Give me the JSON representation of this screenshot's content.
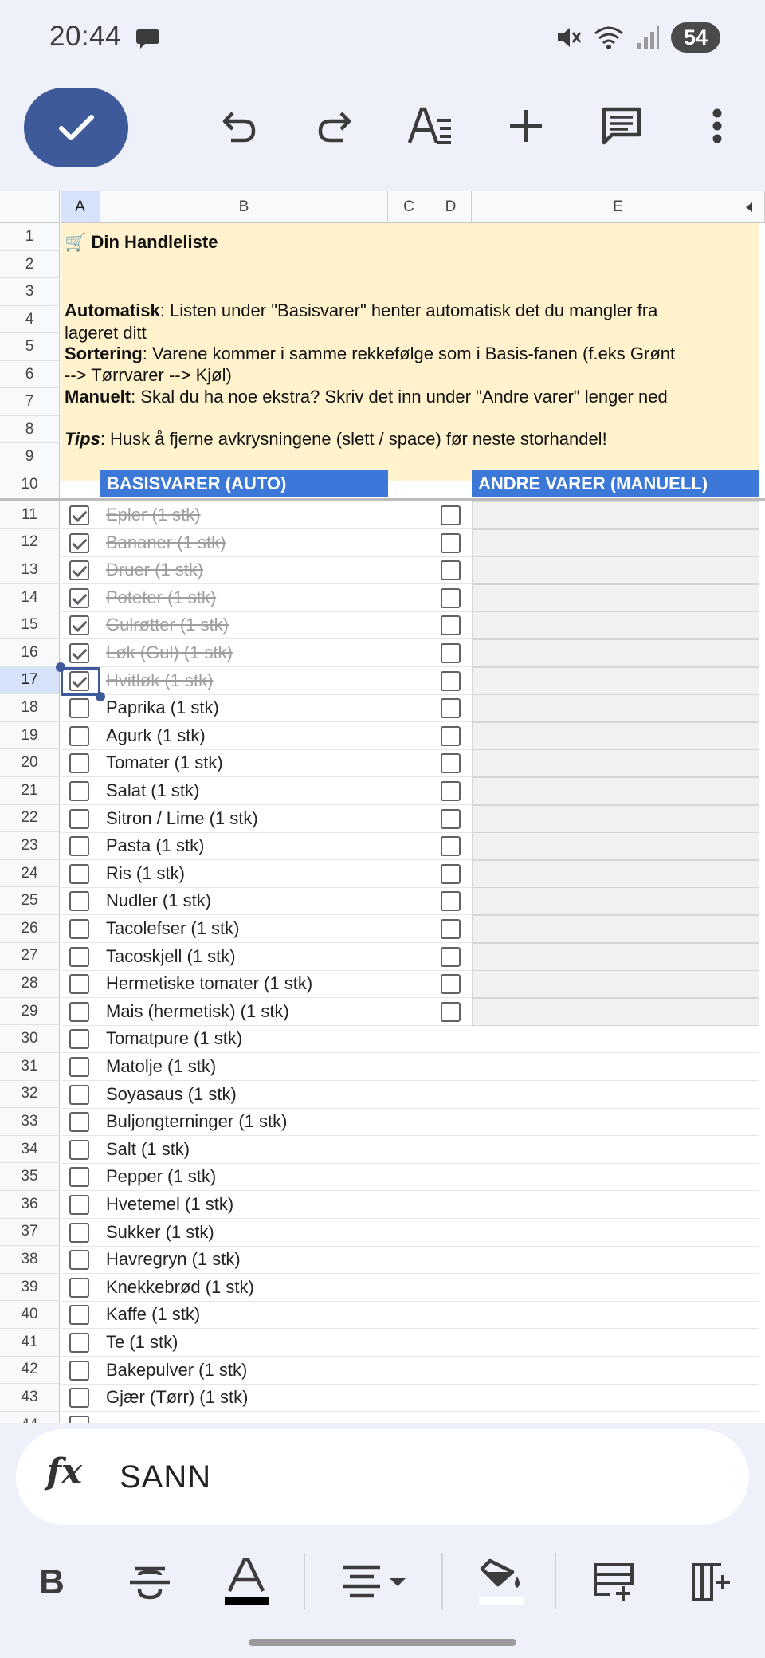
{
  "status_bar": {
    "time": "20:44",
    "battery": "54"
  },
  "toolbar": {
    "done_icon": "check-icon",
    "undo_icon": "undo-icon",
    "redo_icon": "redo-icon",
    "text_format_icon": "text-format-icon",
    "insert_icon": "plus-icon",
    "comment_icon": "comment-icon",
    "more_icon": "more-vert-icon"
  },
  "columns": [
    "A",
    "B",
    "C",
    "D",
    "E"
  ],
  "selected_cell": "A17",
  "info": {
    "title": "🛒 Din Handleliste",
    "auto_label": "Automatisk",
    "auto_text": ": Listen under \"Basisvarer\" henter automatisk det du mangler fra",
    "auto_text2": "lageret ditt",
    "sort_label": "Sortering",
    "sort_text": ": Varene kommer i samme rekkefølge som i Basis-fanen (f.eks Grønt",
    "sort_text2": "--> Tørrvarer --> Kjøl)",
    "manual_label": "Manuelt",
    "manual_text": ": Skal du ha noe ekstra? Skriv det inn under \"Andre varer\" lenger ned",
    "tips_label": "Tips",
    "tips_text": ": Husk å fjerne avkrysningene (slett / space) før neste storhandel!"
  },
  "headers": {
    "basis": "BASISVARER (AUTO)",
    "andre": "ANDRE VARER (MANUELL)"
  },
  "items": [
    {
      "text": "Epler (1 stk)",
      "checked": true
    },
    {
      "text": "Bananer (1 stk)",
      "checked": true
    },
    {
      "text": "Druer (1 stk)",
      "checked": true
    },
    {
      "text": "Poteter (1 stk)",
      "checked": true
    },
    {
      "text": "Gulrøtter (1 stk)",
      "checked": true
    },
    {
      "text": "Løk (Gul) (1 stk)",
      "checked": true
    },
    {
      "text": "Hvitløk (1 stk)",
      "checked": true
    },
    {
      "text": "Paprika (1 stk)",
      "checked": false
    },
    {
      "text": "Agurk (1 stk)",
      "checked": false
    },
    {
      "text": "Tomater (1 stk)",
      "checked": false
    },
    {
      "text": "Salat (1 stk)",
      "checked": false
    },
    {
      "text": "Sitron / Lime (1 stk)",
      "checked": false
    },
    {
      "text": "Pasta (1 stk)",
      "checked": false
    },
    {
      "text": "Ris (1 stk)",
      "checked": false
    },
    {
      "text": "Nudler (1 stk)",
      "checked": false
    },
    {
      "text": "Tacolefser (1 stk)",
      "checked": false
    },
    {
      "text": "Tacoskjell (1 stk)",
      "checked": false
    },
    {
      "text": "Hermetiske tomater (1 stk)",
      "checked": false
    },
    {
      "text": "Mais (hermetisk) (1 stk)",
      "checked": false
    },
    {
      "text": "Tomatpure (1 stk)",
      "checked": false
    },
    {
      "text": "Matolje (1 stk)",
      "checked": false
    },
    {
      "text": "Soyasaus (1 stk)",
      "checked": false
    },
    {
      "text": "Buljongterninger (1 stk)",
      "checked": false
    },
    {
      "text": "Salt (1 stk)",
      "checked": false
    },
    {
      "text": "Pepper (1 stk)",
      "checked": false
    },
    {
      "text": "Hvetemel (1 stk)",
      "checked": false
    },
    {
      "text": "Sukker (1 stk)",
      "checked": false
    },
    {
      "text": "Havregryn (1 stk)",
      "checked": false
    },
    {
      "text": "Knekkebrød (1 stk)",
      "checked": false
    },
    {
      "text": "Kaffe  (1 stk)",
      "checked": false
    },
    {
      "text": "Te (1 stk)",
      "checked": false
    },
    {
      "text": "Bakepulver (1 stk)",
      "checked": false
    },
    {
      "text": "Gjær (Tørr) (1 stk)",
      "checked": false
    }
  ],
  "manual_row_count": 19,
  "formula": {
    "icon": "fx-icon",
    "value": "SANN"
  },
  "format_bar": {
    "bold": "bold-icon",
    "strikethrough": "strikethrough-icon",
    "text_color": "text-color-icon",
    "align": "align-center-icon",
    "fill": "fill-color-icon",
    "insert_row": "insert-row-icon",
    "insert_column": "insert-column-icon"
  },
  "colors": {
    "accent": "#3f5a9b",
    "header_blue": "#3c78d8",
    "info_yellow": "#fff2cc"
  }
}
